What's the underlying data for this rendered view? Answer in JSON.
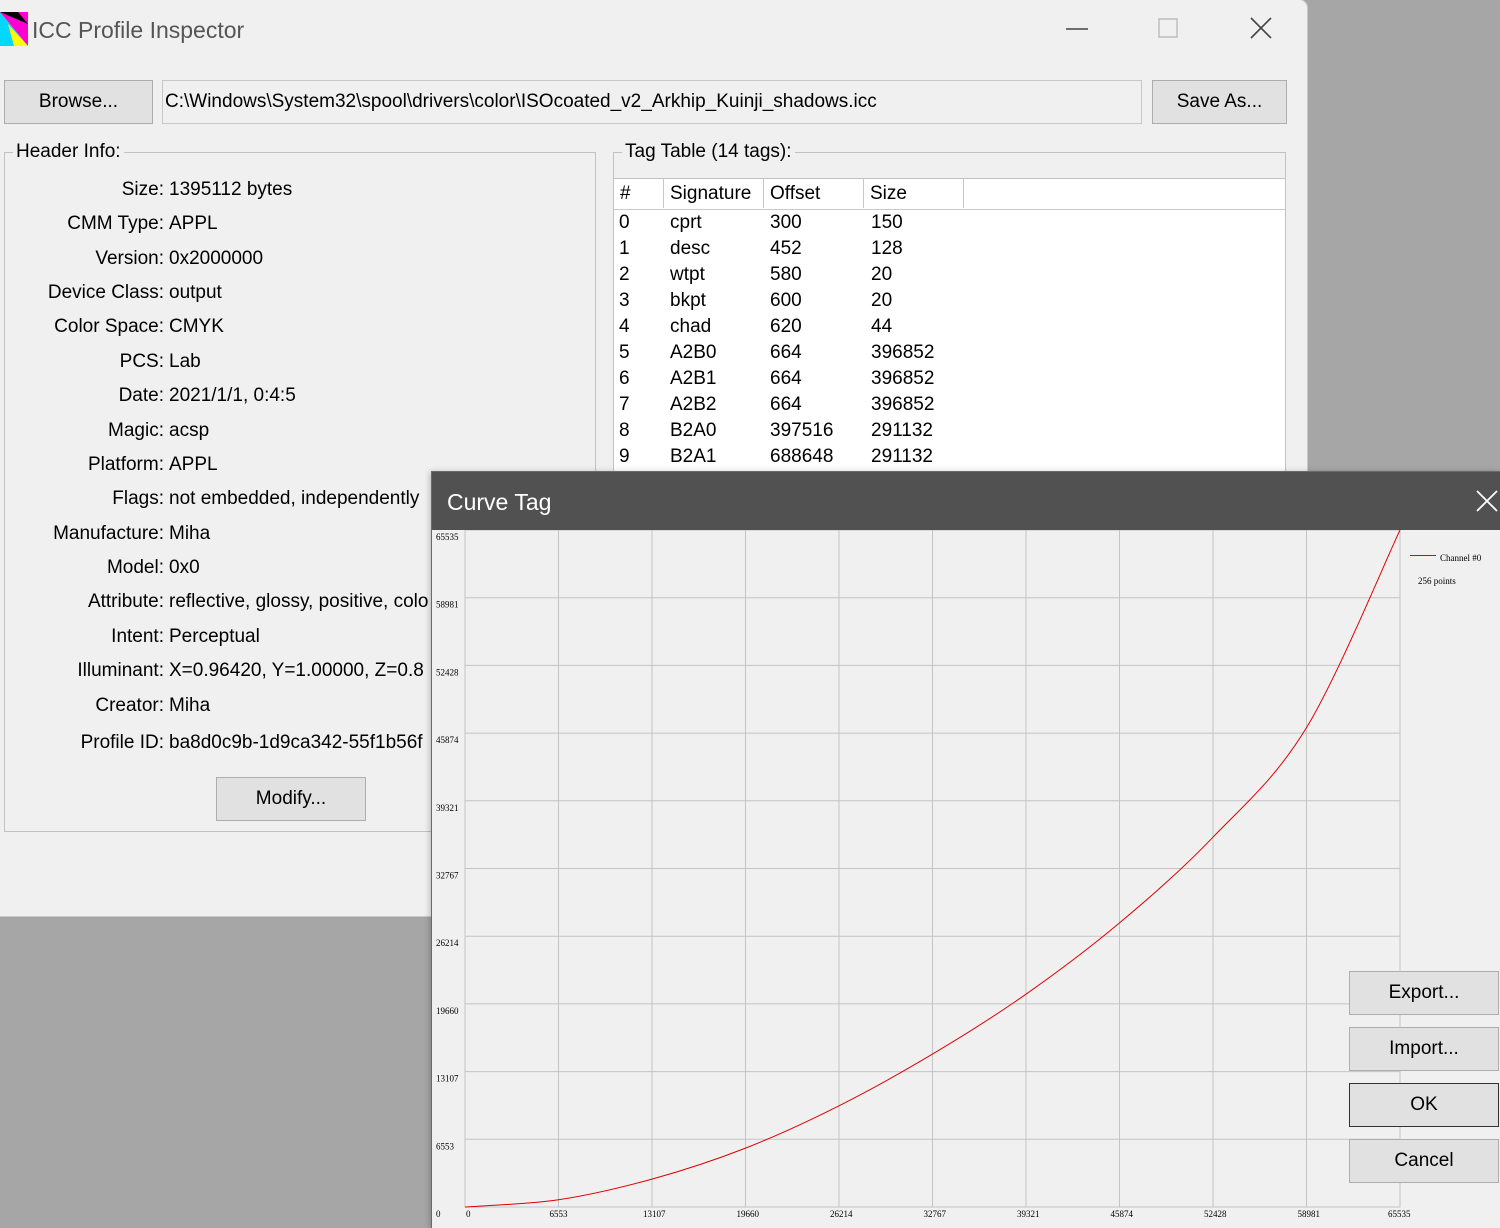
{
  "main_window": {
    "title": "ICC Profile Inspector",
    "browse_label": "Browse...",
    "path": "C:\\Windows\\System32\\spool\\drivers\\color\\ISOcoated_v2_Arkhip_Kuinji_shadows.icc",
    "save_as_label": "Save As...",
    "header_info_title": "Header Info:",
    "modify_label": "Modify...",
    "header_fields": [
      {
        "label": "Size:",
        "value": "1395112 bytes"
      },
      {
        "label": "CMM Type:",
        "value": "APPL"
      },
      {
        "label": "Version:",
        "value": "0x2000000"
      },
      {
        "label": "Device Class:",
        "value": "output"
      },
      {
        "label": "Color Space:",
        "value": "CMYK"
      },
      {
        "label": "PCS:",
        "value": "Lab"
      },
      {
        "label": "Date:",
        "value": "2021/1/1, 0:4:5"
      },
      {
        "label": "Magic:",
        "value": "acsp"
      },
      {
        "label": "Platform:",
        "value": "APPL"
      },
      {
        "label": "Flags:",
        "value": "not embedded, independently"
      },
      {
        "label": "Manufacture:",
        "value": "Miha"
      },
      {
        "label": "Model:",
        "value": "0x0"
      },
      {
        "label": "Attribute:",
        "value": "reflective, glossy, positive, colo"
      },
      {
        "label": "Intent:",
        "value": "Perceptual"
      },
      {
        "label": "Illuminant:",
        "value": "X=0.96420, Y=1.00000, Z=0.8"
      },
      {
        "label": "Creator:",
        "value": "Miha"
      },
      {
        "label": "Profile ID:",
        "value": "ba8d0c9b-1d9ca342-55f1b56f"
      }
    ],
    "tag_table_title": "Tag Table (14 tags):",
    "tag_columns": [
      "#",
      "Signature",
      "Offset",
      "Size"
    ],
    "tag_rows": [
      [
        "0",
        "cprt",
        "300",
        "150"
      ],
      [
        "1",
        "desc",
        "452",
        "128"
      ],
      [
        "2",
        "wtpt",
        "580",
        "20"
      ],
      [
        "3",
        "bkpt",
        "600",
        "20"
      ],
      [
        "4",
        "chad",
        "620",
        "44"
      ],
      [
        "5",
        "A2B0",
        "664",
        "396852"
      ],
      [
        "6",
        "A2B1",
        "664",
        "396852"
      ],
      [
        "7",
        "A2B2",
        "664",
        "396852"
      ],
      [
        "8",
        "B2A0",
        "397516",
        "291132"
      ],
      [
        "9",
        "B2A1",
        "688648",
        "291132"
      ]
    ]
  },
  "curve_dialog": {
    "title": "Curve Tag",
    "export_label": "Export...",
    "import_label": "Import...",
    "ok_label": "OK",
    "cancel_label": "Cancel",
    "curve_color": "#e00000"
  },
  "chart_data": {
    "type": "line",
    "x_ticks": [
      "0",
      "6553",
      "13107",
      "19660",
      "26214",
      "32767",
      "39321",
      "45874",
      "52428",
      "58981",
      "65535"
    ],
    "y_ticks": [
      "0",
      "6553",
      "13107",
      "19660",
      "26214",
      "32767",
      "39321",
      "45874",
      "52428",
      "58981",
      "65535"
    ],
    "xlim": [
      0,
      65535
    ],
    "ylim": [
      0,
      65535
    ],
    "grid": true,
    "legend_placement": "top-right",
    "series": [
      {
        "name": "Channel #0",
        "points_label": "256 points",
        "x": [
          0,
          6553,
          13107,
          19660,
          26214,
          32767,
          39321,
          45874,
          52428,
          58981,
          65535
        ],
        "y": [
          0,
          700,
          2700,
          5700,
          9800,
          14800,
          20600,
          27500,
          35800,
          46400,
          65535
        ]
      }
    ]
  }
}
